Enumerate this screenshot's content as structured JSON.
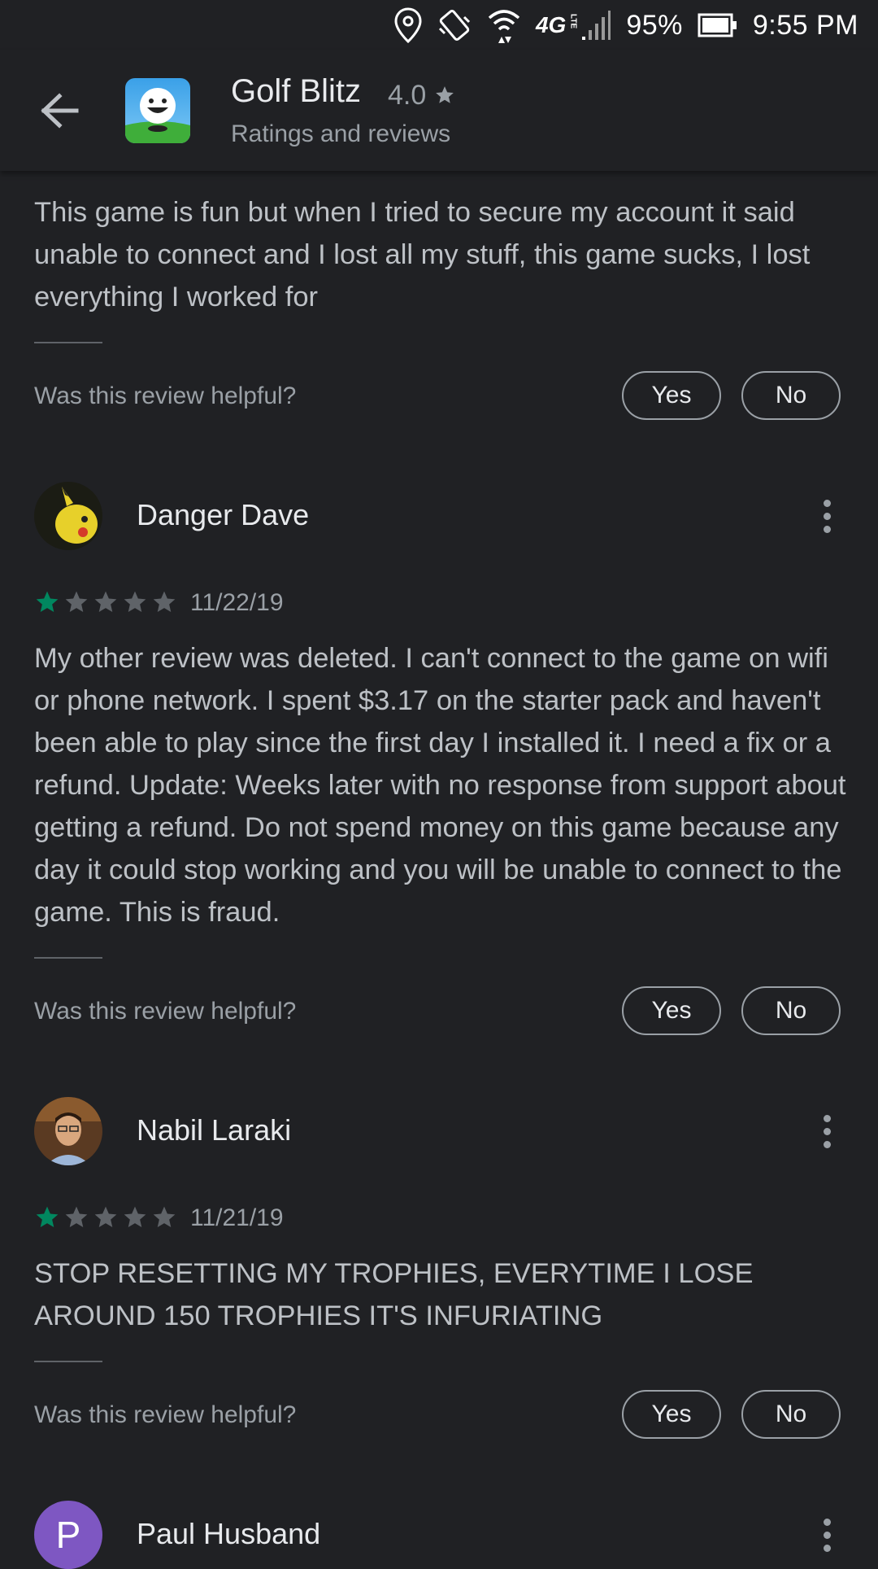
{
  "status_bar": {
    "battery": "95%",
    "time": "9:55 PM",
    "network": "4G",
    "icons": [
      "location-icon",
      "vibrate-icon",
      "wifi-icon",
      "lte-icon",
      "signal-icon",
      "battery-icon"
    ]
  },
  "header": {
    "app_name": "Golf Blitz",
    "rating": "4.0",
    "subtitle": "Ratings and reviews"
  },
  "reviews": [
    {
      "text": "This game is fun but when I tried to secure my account it said unable to connect and I lost all my stuff, this game sucks, I lost everything I worked for",
      "helpful_question": "Was this review helpful?",
      "yes": "Yes",
      "no": "No"
    },
    {
      "name": "Danger Dave",
      "stars": 1,
      "date": "11/22/19",
      "text": "My other review was deleted. I can't connect to the game on wifi or phone network. I spent $3.17 on the starter pack and haven't been able to play since the first day I installed it. I need a fix or a refund. Update: Weeks later with no response from support about getting a refund. Do not spend money on this game because any day it could stop working and you will be unable to connect to the game. This is fraud.",
      "helpful_question": "Was this review helpful?",
      "yes": "Yes",
      "no": "No"
    },
    {
      "name": "Nabil Laraki",
      "stars": 1,
      "date": "11/21/19",
      "text": "STOP RESETTING MY TROPHIES, EVERYTIME I LOSE AROUND 150 TROPHIES IT'S INFURIATING",
      "helpful_question": "Was this review helpful?",
      "yes": "Yes",
      "no": "No"
    },
    {
      "name": "Paul Husband",
      "avatar_letter": "P"
    }
  ],
  "colors": {
    "background": "#202124",
    "star_filled": "#01875f",
    "star_empty": "#5f6368",
    "avatar_purple": "#7e57c2"
  }
}
